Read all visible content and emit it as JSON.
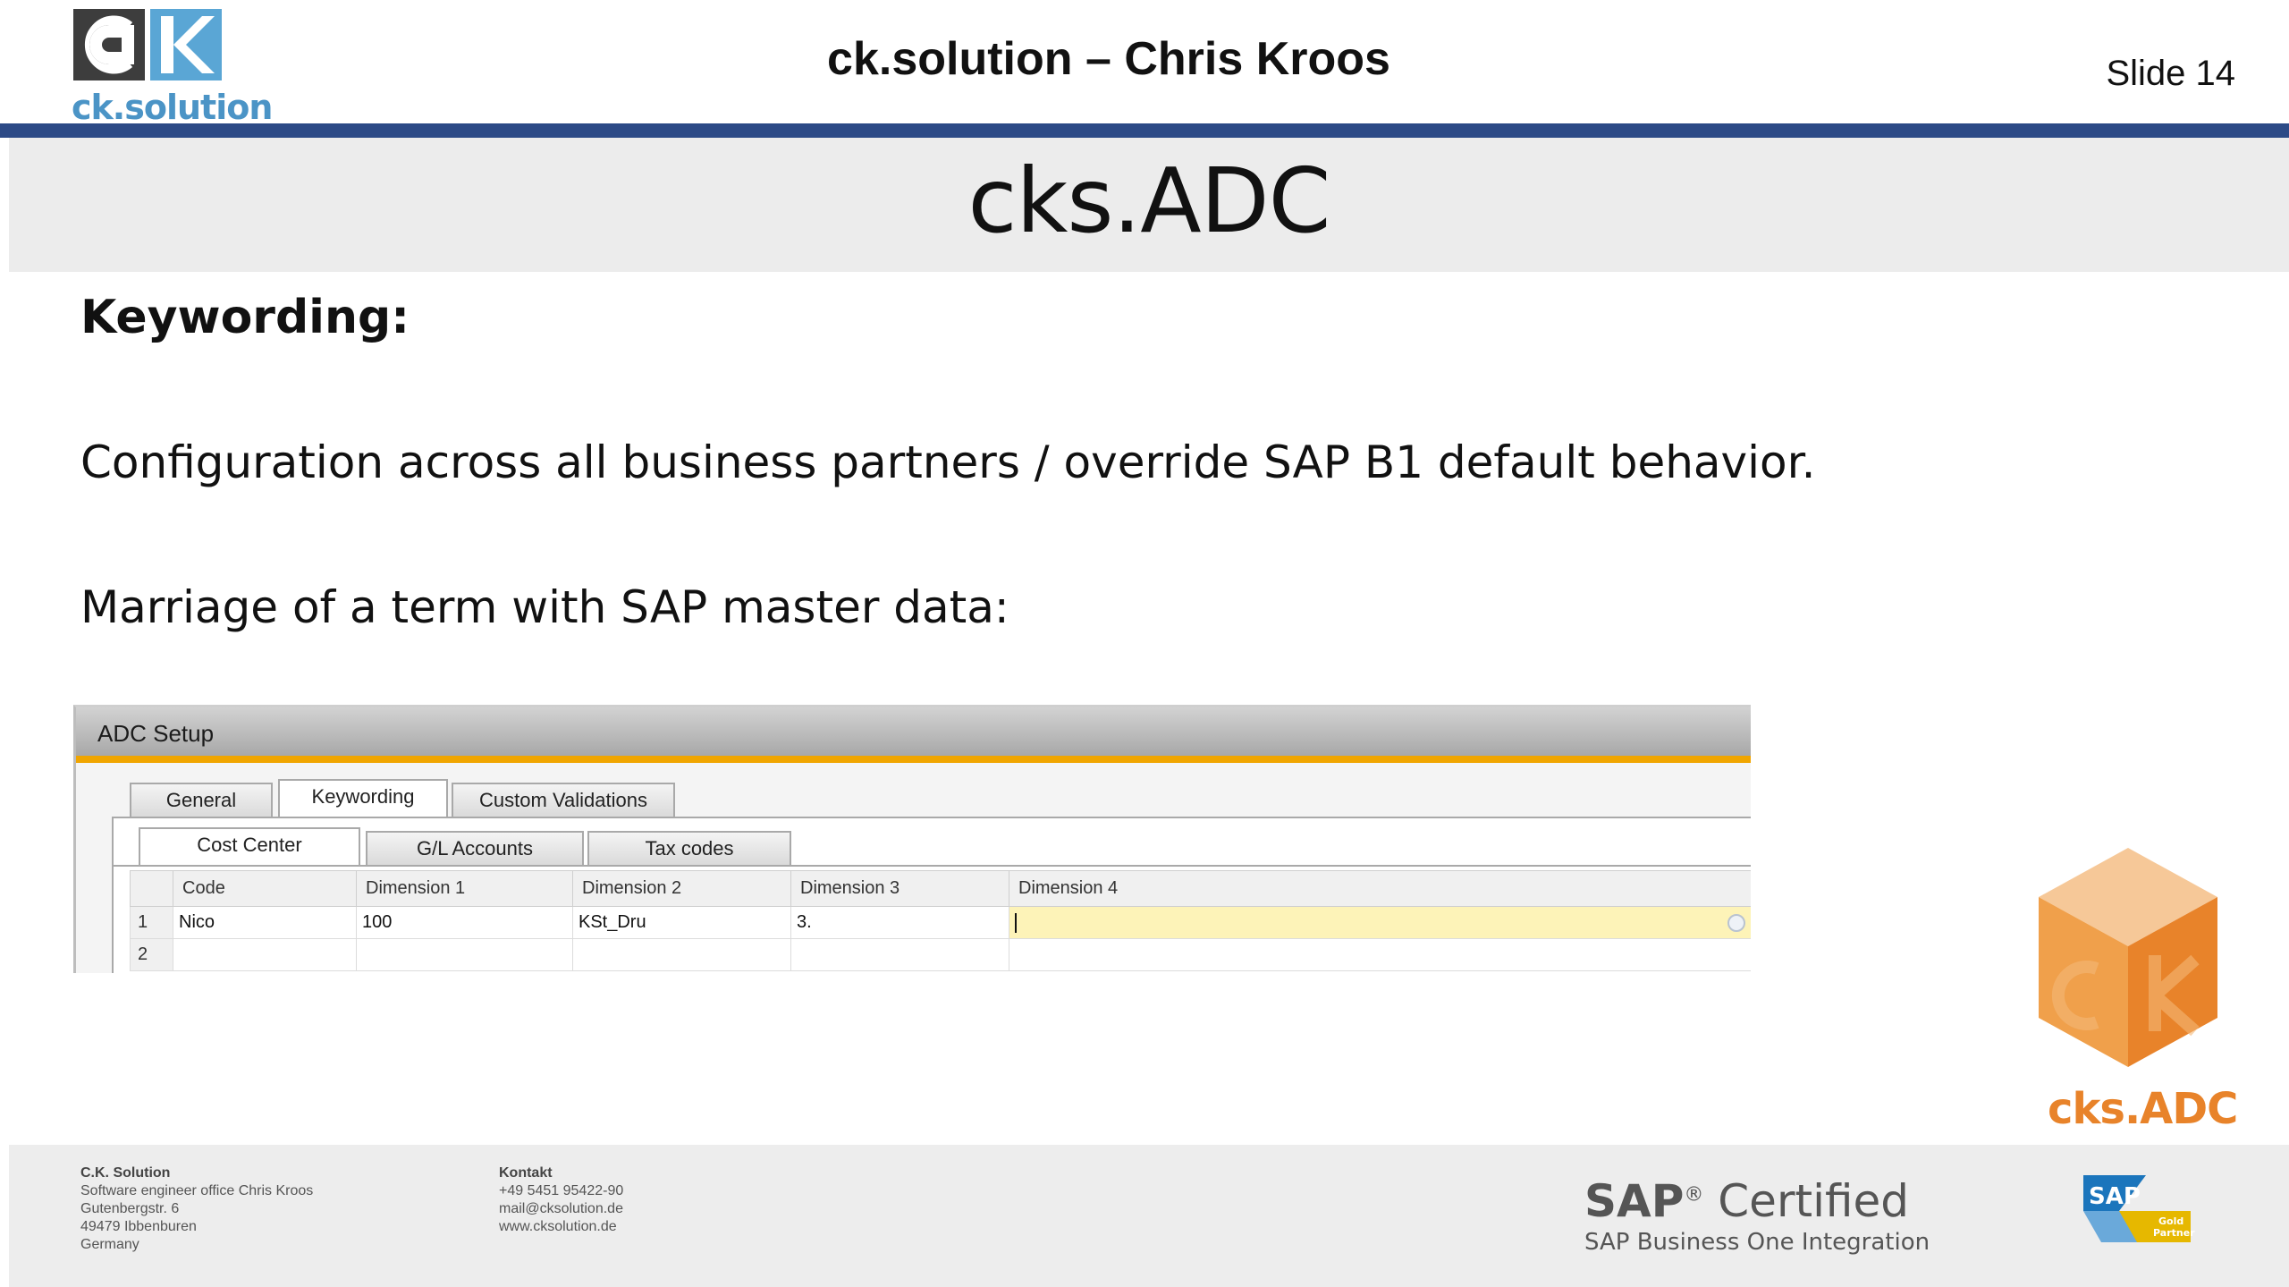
{
  "header": {
    "logo_text": "ck.solution",
    "deck_title": "ck.solution – Chris Kroos",
    "slide_number": "Slide 14",
    "accent_color": "#2c4a86"
  },
  "slide": {
    "title": "cks.ADC",
    "section_heading": "Keywording:",
    "paragraph1": "Configuration across all business partners / override SAP B1 default behavior.",
    "paragraph2": "Marriage of a term with SAP master data:"
  },
  "window": {
    "title": "ADC Setup",
    "tabs": [
      {
        "label": "General",
        "active": false
      },
      {
        "label": "Keywording",
        "active": true
      },
      {
        "label": "Custom Validations",
        "active": false
      }
    ],
    "subtabs": [
      {
        "label": "Cost Center",
        "active": true
      },
      {
        "label": "G/L Accounts",
        "active": false
      },
      {
        "label": "Tax codes",
        "active": false
      }
    ],
    "columns": [
      "Code",
      "Dimension 1",
      "Dimension 2",
      "Dimension 3",
      "Dimension 4"
    ],
    "rows": [
      {
        "num": "1",
        "cells": [
          "Nico",
          "100",
          "KSt_Dru",
          "3.",
          ""
        ]
      },
      {
        "num": "2",
        "cells": [
          "",
          "",
          "",
          "",
          ""
        ]
      }
    ]
  },
  "cube_logo": {
    "label": "cks.ADC",
    "color": "#e8832a"
  },
  "footer": {
    "company": {
      "heading": "C.K. Solution",
      "lines": [
        "Software engineer office Chris Kroos",
        "Gutenbergstr. 6",
        "49479 Ibbenburen",
        "Germany"
      ]
    },
    "contact": {
      "heading": "Kontakt",
      "lines": [
        "+49 5451 95422-90",
        "mail@cksolution.de",
        "www.cksolution.de"
      ]
    },
    "sap_certified": {
      "sap": "SAP",
      "reg": "®",
      "certified": "Certified",
      "subtitle": "SAP Business One Integration"
    },
    "sap_badge": {
      "sap": "SAP",
      "line1": "Gold",
      "line2": "Partner"
    }
  }
}
